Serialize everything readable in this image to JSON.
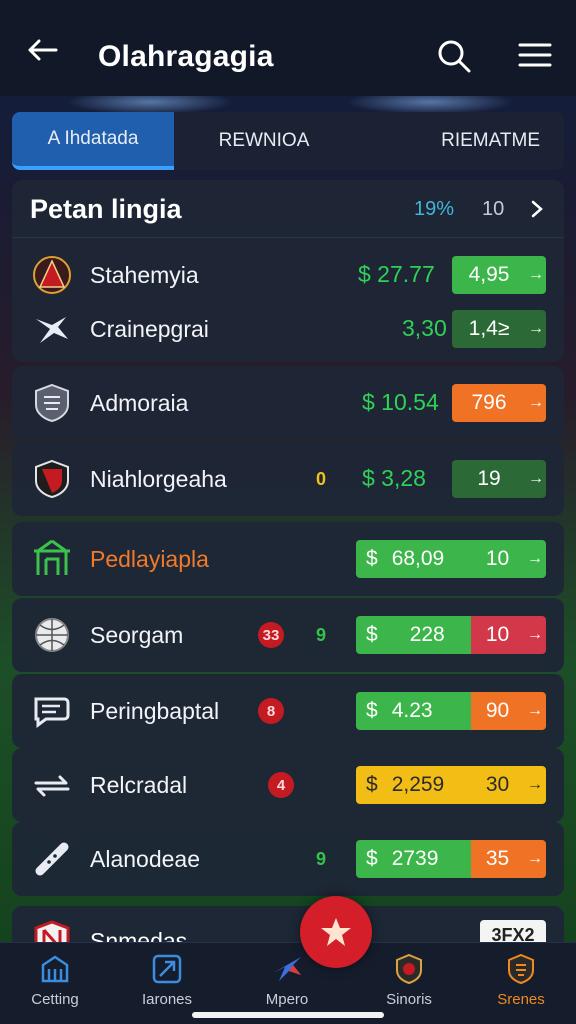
{
  "header": {
    "title": "Olahragagia"
  },
  "tabs": [
    {
      "label": "A Ihdatada",
      "active": true
    },
    {
      "label": "REWNIOA",
      "active": false
    },
    {
      "label": "RIEMATME",
      "active": false
    }
  ],
  "panel": {
    "title": "Petan lingia",
    "pct": "19%",
    "count": "10"
  },
  "rows": [
    {
      "name": "Stahemyia",
      "price": "$ 27.77",
      "odds": "4,95"
    },
    {
      "name": "Crainepgrai",
      "price": "3,30",
      "odds": "1,4≥"
    },
    {
      "name": "Admoraia",
      "price": "$ 10.54",
      "odds": "796"
    },
    {
      "name": "Niahlorgeaha",
      "badge": "0",
      "price": "$ 3,28",
      "odds": "19"
    },
    {
      "name": "Pedlayiapla",
      "currency": "$",
      "price": "68,09",
      "odds": "10"
    },
    {
      "name": "Seorgam",
      "badge": "33",
      "badge2": "9",
      "currency": "$",
      "price": "228",
      "odds": "10"
    },
    {
      "name": "Peringbaptal",
      "badge": "8",
      "currency": "$",
      "price": "4.23",
      "odds": "90"
    },
    {
      "name": "Relcradal",
      "badge": "4",
      "currency": "$",
      "price": "2,259",
      "odds": "30"
    },
    {
      "name": "Alanodeae",
      "badge2": "9",
      "currency": "$",
      "price": "2739",
      "odds": "35"
    }
  ],
  "partial_row": {
    "name": "Snmedas",
    "tag": "3FX2"
  },
  "bottom_nav": [
    {
      "label": "Cetting",
      "active": false
    },
    {
      "label": "Iarones",
      "active": false
    },
    {
      "label": "Mpero",
      "active": false
    },
    {
      "label": "Sinoris",
      "active": false
    },
    {
      "label": "Srenes",
      "active": true
    }
  ],
  "colors": {
    "accent": "#1f5fae",
    "price_green": "#2fd156",
    "active_orange": "#f08a1e",
    "fab_red": "#d41f2b"
  },
  "icons": [
    "back-arrow-icon",
    "search-icon",
    "menu-icon",
    "chevron-right-icon",
    "star-icon"
  ]
}
